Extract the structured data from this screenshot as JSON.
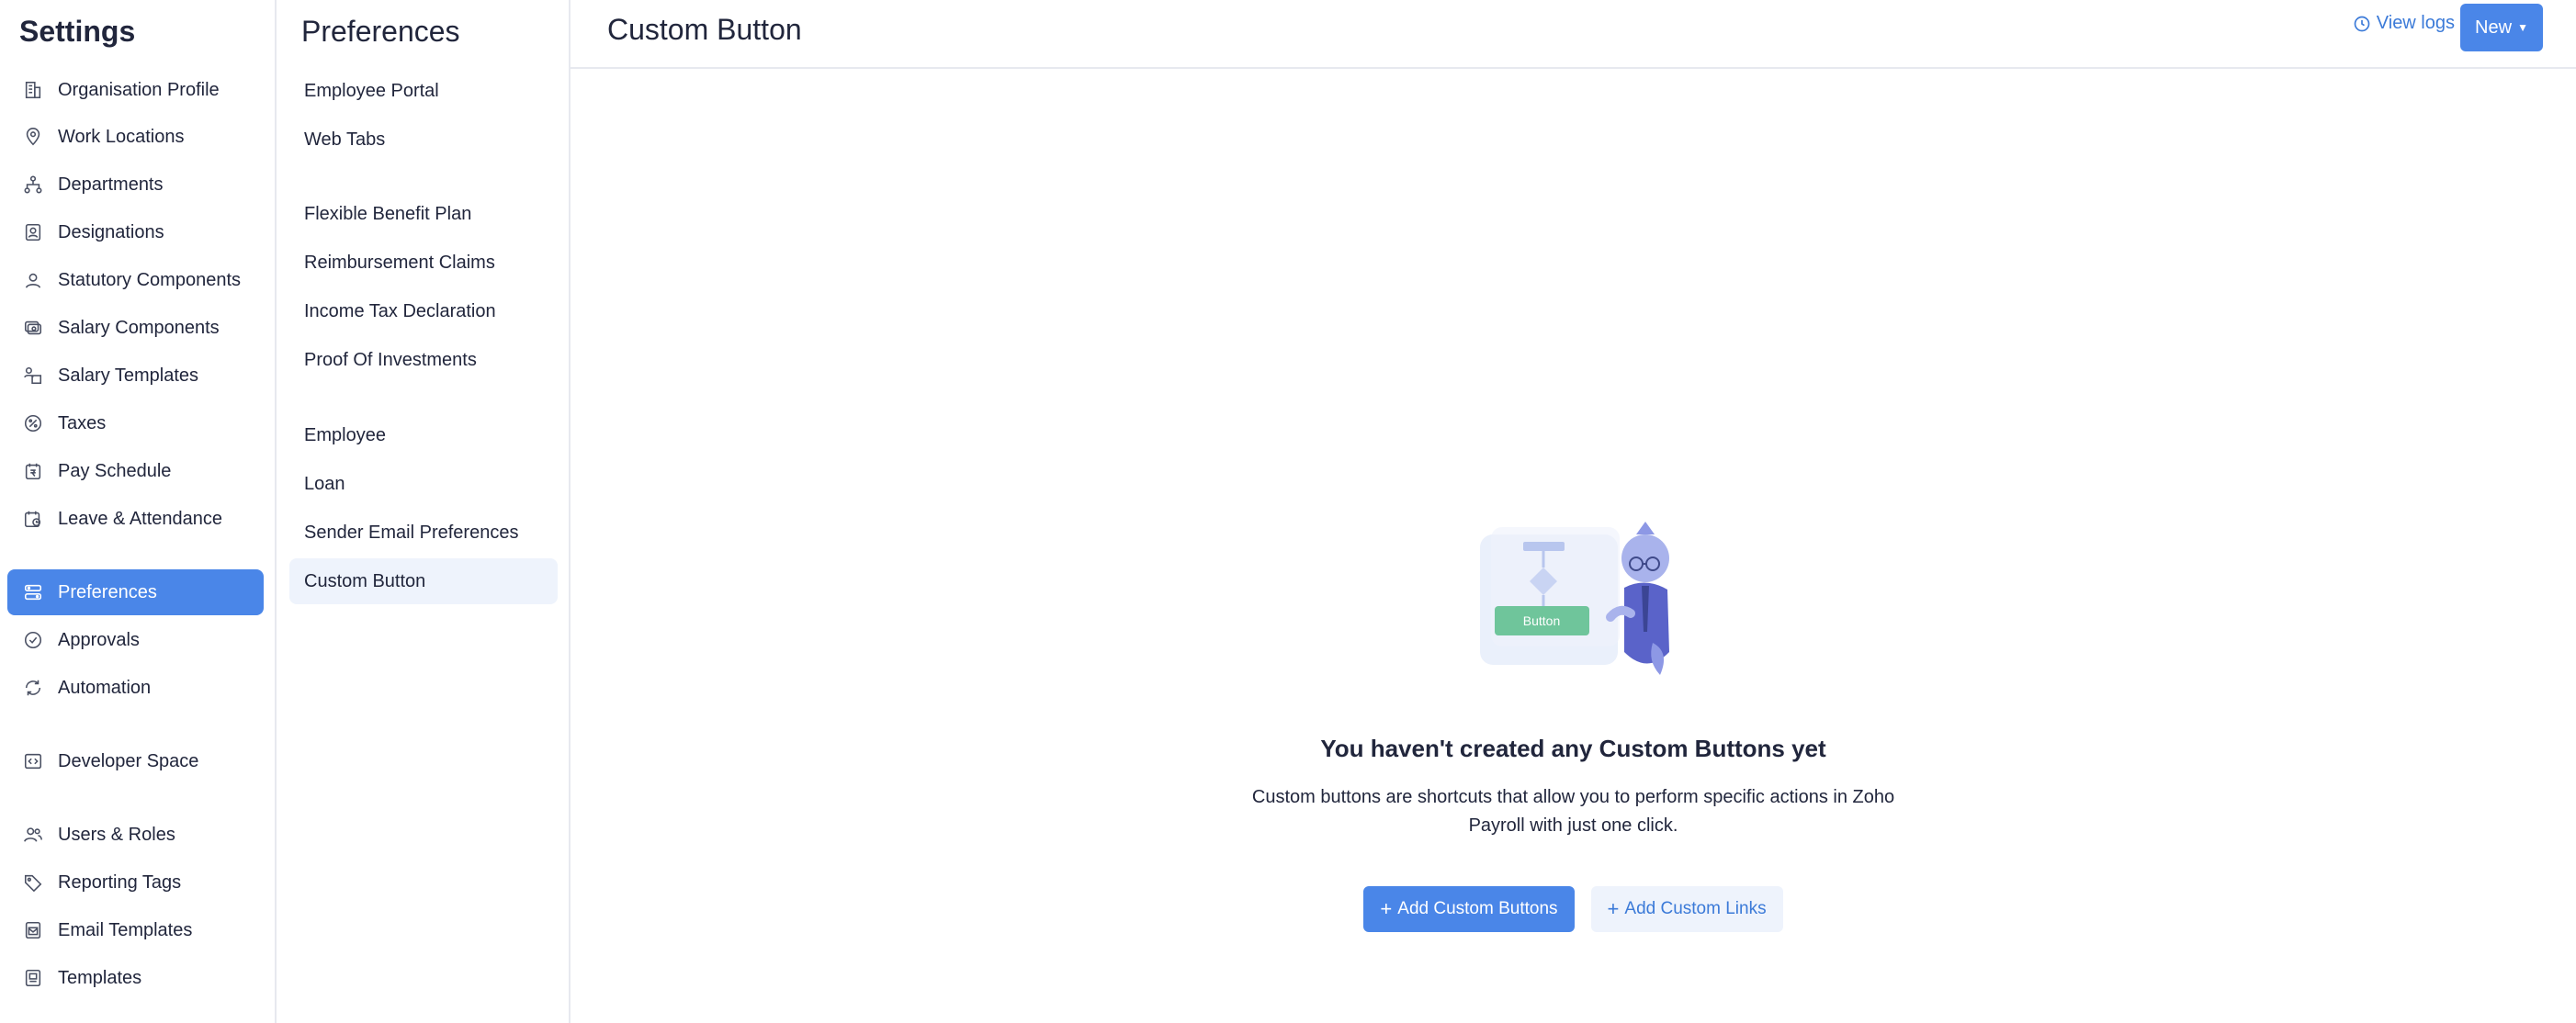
{
  "settings_sidebar": {
    "title": "Settings",
    "items": [
      {
        "label": "Organisation Profile",
        "icon": "building-icon"
      },
      {
        "label": "Work Locations",
        "icon": "location-pin-icon"
      },
      {
        "label": "Departments",
        "icon": "org-chart-icon"
      },
      {
        "label": "Designations",
        "icon": "id-badge-icon"
      },
      {
        "label": "Statutory Components",
        "icon": "shield-user-icon"
      },
      {
        "label": "Salary Components",
        "icon": "salary-icon"
      },
      {
        "label": "Salary Templates",
        "icon": "template-user-icon"
      },
      {
        "label": "Taxes",
        "icon": "percent-icon"
      },
      {
        "label": "Pay Schedule",
        "icon": "calendar-rupee-icon"
      },
      {
        "label": "Leave & Attendance",
        "icon": "calendar-clock-icon"
      },
      {
        "label": "Preferences",
        "icon": "preferences-icon"
      },
      {
        "label": "Approvals",
        "icon": "check-circle-icon"
      },
      {
        "label": "Automation",
        "icon": "refresh-icon"
      },
      {
        "label": "Developer Space",
        "icon": "code-icon"
      },
      {
        "label": "Users & Roles",
        "icon": "users-icon"
      },
      {
        "label": "Reporting Tags",
        "icon": "tag-icon"
      },
      {
        "label": "Email Templates",
        "icon": "email-template-icon"
      },
      {
        "label": "Templates",
        "icon": "templates-icon"
      }
    ]
  },
  "preferences_sidebar": {
    "title": "Preferences",
    "items": [
      {
        "label": "Employee Portal"
      },
      {
        "label": "Web Tabs"
      },
      {
        "label": "Flexible Benefit Plan"
      },
      {
        "label": "Reimbursement Claims"
      },
      {
        "label": "Income Tax Declaration"
      },
      {
        "label": "Proof Of Investments"
      },
      {
        "label": "Employee"
      },
      {
        "label": "Loan"
      },
      {
        "label": "Sender Email Preferences"
      },
      {
        "label": "Custom Button"
      }
    ]
  },
  "header": {
    "title": "Custom Button",
    "view_logs": "View logs",
    "new_button": "New"
  },
  "empty_state": {
    "illustration_text": "Button",
    "heading": "You haven't created any Custom Buttons yet",
    "description": "Custom buttons are shortcuts that allow you to perform specific actions in Zoho Payroll with just one click.",
    "primary_action": "Add Custom Buttons",
    "secondary_action": "Add Custom Links"
  },
  "colors": {
    "accent": "#4a86e8",
    "link": "#3b7ad8",
    "active_bg_light": "#eef3fc"
  }
}
